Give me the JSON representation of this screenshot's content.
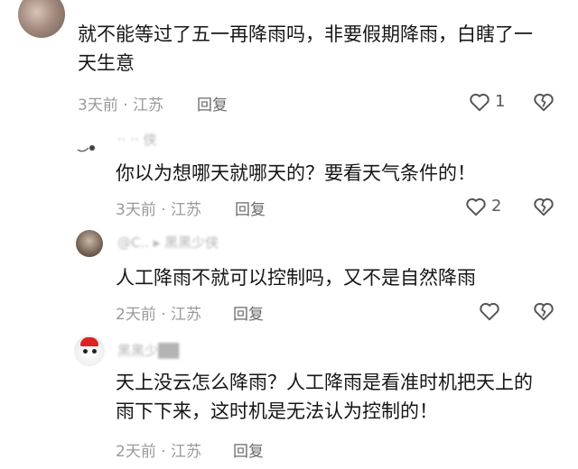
{
  "comments": [
    {
      "text": "就不能等过了五一再降雨吗，非要假期降雨，白瞎了一\n天生意",
      "time_location": "3天前 · 江苏",
      "reply_label": "回复",
      "likes": "1"
    },
    {
      "username": "·· ·· 侠",
      "text": "你以为想哪天就哪天的？要看天气条件的！",
      "time_location": "3天前 · 江苏",
      "reply_label": "回复",
      "likes": "2"
    },
    {
      "username": "@C.. ▸ 黑黑少侠",
      "text": "人工降雨不就可以控制吗，又不是自然降雨",
      "time_location": "2天前 · 江苏",
      "reply_label": "回复",
      "likes": ""
    },
    {
      "username": "黑黑少██",
      "text": "天上没云怎么降雨？人工降雨是看准时机把天上的\n雨下下来，这时机是无法认为控制的！",
      "time_location": "2天前 · 江苏",
      "reply_label": "回复",
      "likes": ""
    }
  ],
  "icons": {
    "like": "heart-outline-icon",
    "dislike": "broken-heart-icon"
  }
}
